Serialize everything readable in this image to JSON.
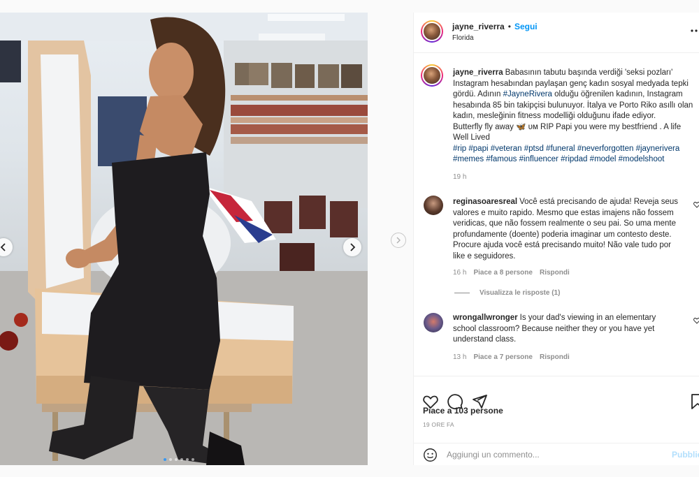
{
  "post": {
    "username": "jayne_riverra",
    "follow_label": "Segui",
    "location": "Florida",
    "more_icon": "more-options-icon",
    "caption": {
      "username": "jayne_riverra",
      "text_lines": [
        "Babasının tabutu başında verdiği 'seksi pozları'",
        "Instagram hesabından paylaşan genç kadın sosyal medyada tepki",
        "gördü. Adının",
        "olduğu öğrenilen kadının, Instagram",
        "hesabında 85 bin takipçisi bulunuyor. İtalya ve Porto Riko asıllı olan",
        "kadın, mesleğinin fitness modelliği olduğunu ifade ediyor.",
        "Butterfly fly away 🦋 ᴜᴍ RIP Papi you were my bestfriend . A life",
        "Well Lived"
      ],
      "mention_tag": "#JayneRivera",
      "hashtags_line1": [
        "#rip",
        "#papi",
        "#veteran",
        "#ptsd",
        "#funeral",
        "#neverforgotten",
        "#jaynerivera"
      ],
      "hashtags_line2": [
        "#memes",
        "#famous",
        "#influencer",
        "#ripdad",
        "#model",
        "#modelshoot"
      ],
      "time": "19 h"
    },
    "comments": [
      {
        "username": "reginasoaresreal",
        "text_lines": [
          "Você está precisando de ajuda! Reveja seus",
          "valores e muito rapido. Mesmo que estas imajens não fossem",
          "veridicas, que não fossem realmente o seu pai. So uma mente",
          "profundamente (doente) poderia imaginar um contesto deste.",
          "Procure ajuda você está precisando muito! Não vale tudo por",
          "like e seguidores."
        ],
        "time": "16 h",
        "likes": "Piace a 8 persone",
        "reply": "Rispondi",
        "view_replies": "Visualizza le risposte (1)"
      },
      {
        "username": "wrongallwronger",
        "text_lines": [
          "Is your dad's viewing in an elementary",
          "school classroom? Because neither they or you have yet",
          "understand class."
        ],
        "time": "13 h",
        "likes": "Piace a 7 persone",
        "reply": "Rispondi"
      }
    ],
    "likes_summary": "Piace a 103 persone",
    "timestamp": "19 ORE FA",
    "comment_placeholder": "Aggiungi un commento...",
    "publish_label": "Pubblica"
  },
  "carousel": {
    "total_slides": 6,
    "active_slide": 1,
    "dot_color_active": "#3897f0"
  },
  "colors": {
    "follow": "#0095f6",
    "hashtag": "#00376b",
    "muted": "#8e8e8e",
    "publish_disabled": "#b2dffc"
  }
}
